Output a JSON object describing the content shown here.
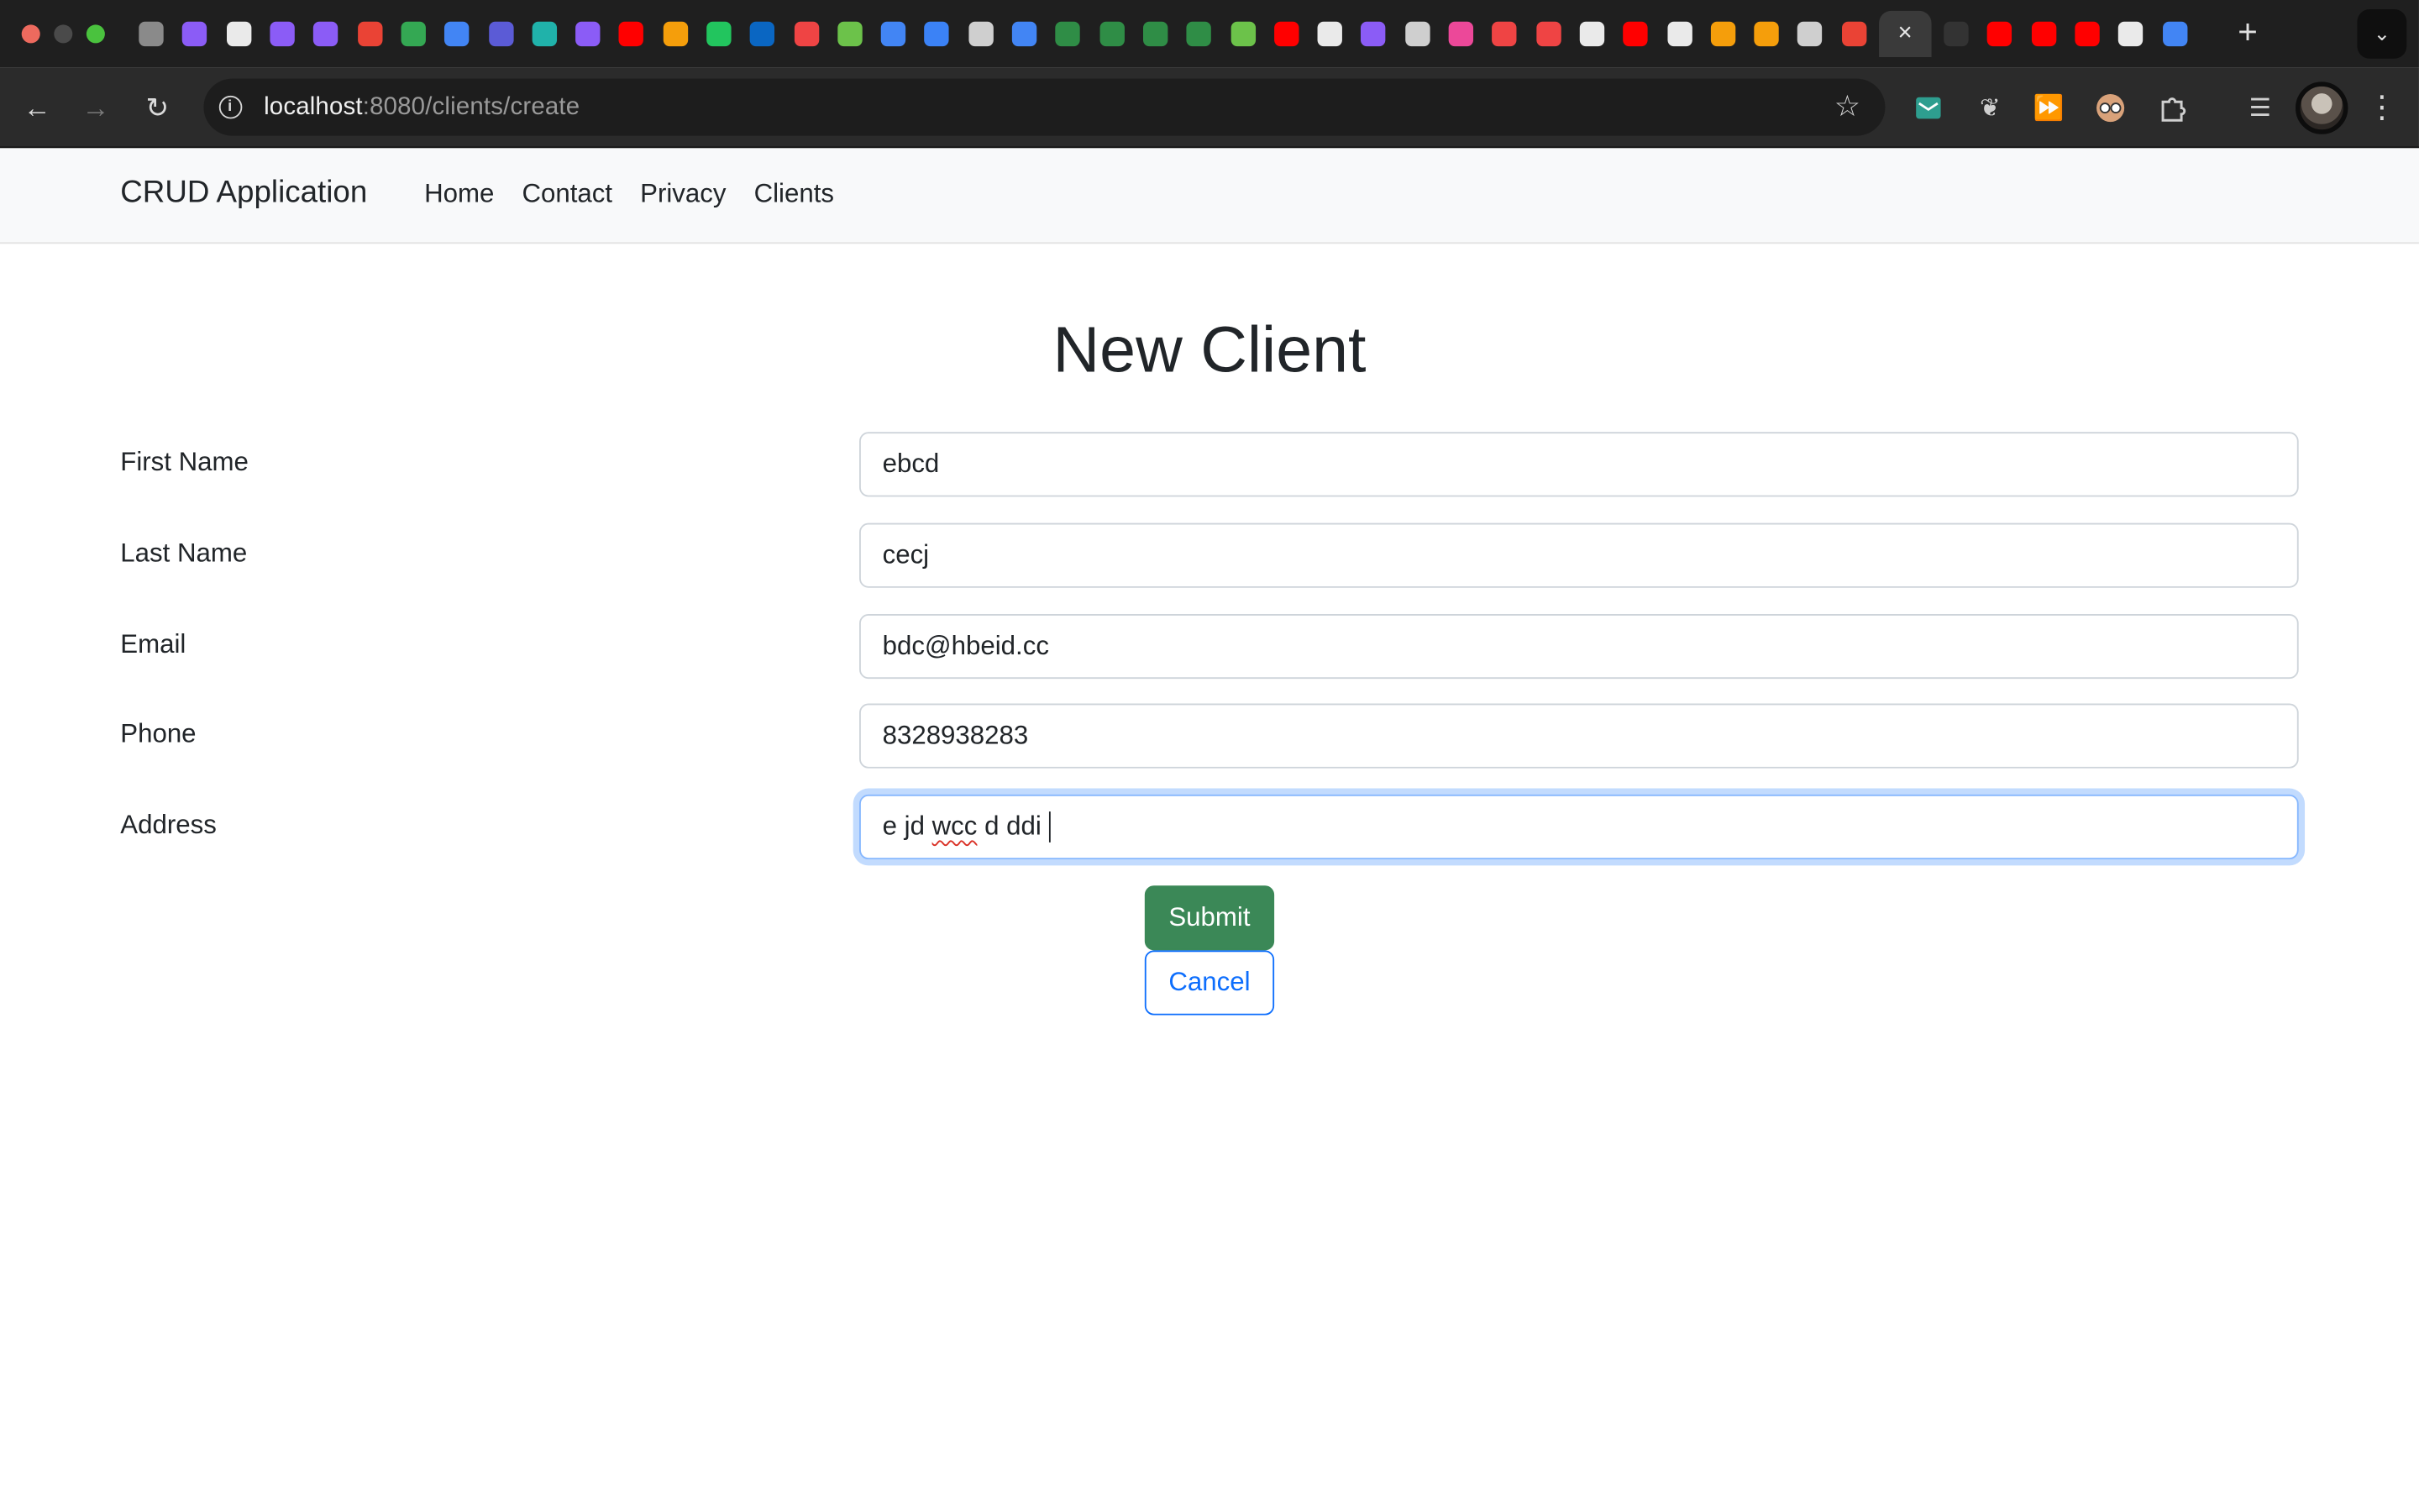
{
  "browser": {
    "url_host": "localhost",
    "url_rest": ":8080/clients/create",
    "active_tab_close": "×",
    "new_tab": "+",
    "tab_icon_colors": [
      "#8a8a8a",
      "#8b5cf6",
      "#eaeaea",
      "#8b5cf6",
      "#8b5cf6",
      "#ea4335",
      "#34a853",
      "#4285f4",
      "#5b5bd6",
      "#20b2aa",
      "#8b5cf6",
      "#ff0000",
      "#f59e0b",
      "#22c55e",
      "#0a66c2",
      "#ef4444",
      "#6cc24a",
      "#4285f4",
      "#3b82f6",
      "#cfcfcf",
      "#4285f4",
      "#2f8d46",
      "#2f8d46",
      "#2f8d46",
      "#2f8d46",
      "#6cc24a",
      "#ff0000",
      "#eaeaea",
      "#8b5cf6",
      "#cfcfcf",
      "#ec4899",
      "#ef4444",
      "#ef4444",
      "#eaeaea",
      "#ff0000",
      "#eaeaea",
      "#f59e0b",
      "#f59e0b",
      "#cfcfcf",
      "#ea4335"
    ],
    "tab_icon_colors_after": [
      "#333333",
      "#ff0000",
      "#ff0000",
      "#ff0000",
      "#eaeaea",
      "#4285f4"
    ]
  },
  "app": {
    "brand": "CRUD Application",
    "nav": [
      "Home",
      "Contact",
      "Privacy",
      "Clients"
    ]
  },
  "form": {
    "title": "New Client",
    "fields": [
      {
        "label": "First Name",
        "value": "ebcd"
      },
      {
        "label": "Last Name",
        "value": "cecj"
      },
      {
        "label": "Email",
        "value": "bdc@hbeid.cc"
      },
      {
        "label": "Phone",
        "value": "8328938283"
      },
      {
        "label": "Address",
        "value_pre": "e jd ",
        "value_misspelled": "wcc",
        "value_post": " d ddi"
      }
    ],
    "submit_label": "Submit",
    "cancel_label": "Cancel"
  }
}
